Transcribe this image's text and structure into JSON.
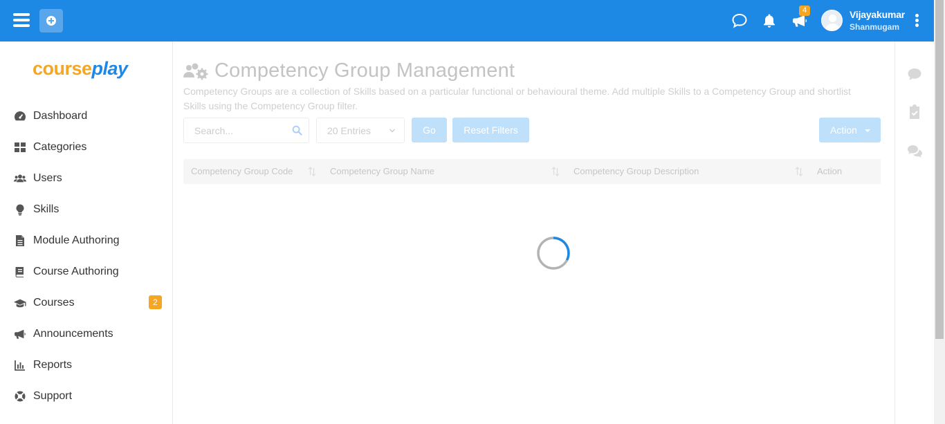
{
  "header": {
    "user_name": "Vijayakumar",
    "user_subtitle": "Shanmugam",
    "announcements_badge": "4",
    "accent_color": "#1e88e5"
  },
  "sidebar": {
    "logo_part1": "course",
    "logo_part2": "play",
    "items": [
      {
        "label": "Dashboard",
        "icon": "tachometer-icon"
      },
      {
        "label": "Categories",
        "icon": "grid-icon"
      },
      {
        "label": "Users",
        "icon": "users-icon"
      },
      {
        "label": "Skills",
        "icon": "lightbulb-icon"
      },
      {
        "label": "Module Authoring",
        "icon": "file-icon"
      },
      {
        "label": "Course Authoring",
        "icon": "book-icon"
      },
      {
        "label": "Courses",
        "icon": "graduation-cap-icon",
        "badge": "2"
      },
      {
        "label": "Announcements",
        "icon": "bullhorn-icon"
      },
      {
        "label": "Reports",
        "icon": "bar-chart-icon"
      },
      {
        "label": "Support",
        "icon": "life-ring-icon"
      }
    ]
  },
  "main": {
    "title": "Competency Group Management",
    "description": "Competency Groups are a collection of Skills based on a particular functional or behavioural theme. Add multiple Skills to a Competency Group and shortlist Skills using the Competency Group filter.",
    "search_placeholder": "Search...",
    "entries_value": "20 Entries",
    "go_label": "Go",
    "reset_label": "Reset Filters",
    "action_label": "Action",
    "columns": [
      "Competency Group Code",
      "Competency Group Name",
      "Competency Group Description",
      "Action"
    ]
  }
}
